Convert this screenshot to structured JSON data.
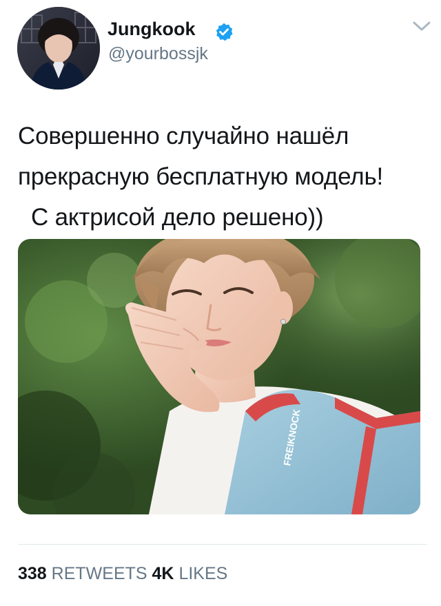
{
  "user": {
    "display_name": "Jungkook",
    "username": "@yourbossjk",
    "verified": true
  },
  "tweet": {
    "lines": [
      "Совершенно случайно нашёл",
      "прекрасную бесплатную модель!",
      "  С актрисой дело решено))"
    ],
    "photo_icon": "portrait-photo"
  },
  "stats": {
    "retweets_count": "338",
    "retweets_label": "RETWEETS",
    "likes_count": "4K",
    "likes_label": "LIKES"
  },
  "colors": {
    "text": "#14171a",
    "secondary": "#657786",
    "verified": "#1da1f2",
    "divider": "#e1e8ed"
  }
}
